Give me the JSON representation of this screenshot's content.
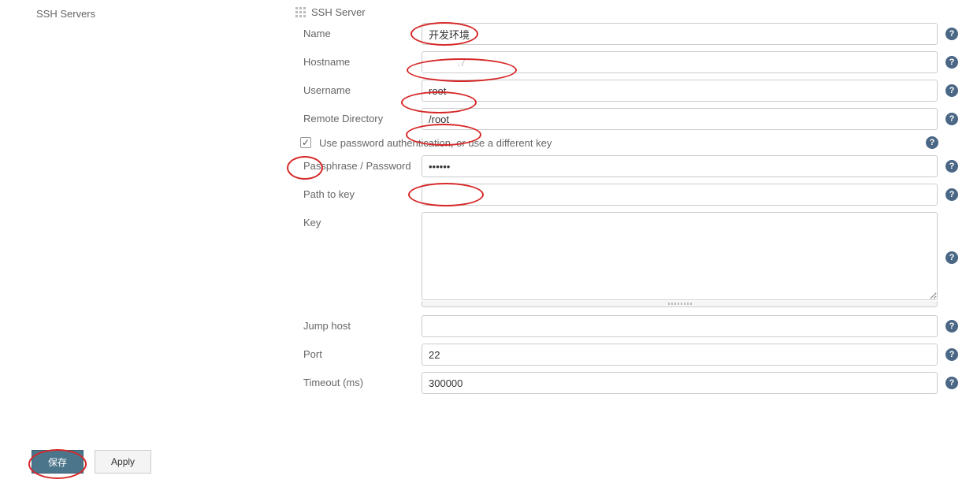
{
  "sidebar": {
    "label": "SSH Servers"
  },
  "section": {
    "title": "SSH Server"
  },
  "fields": {
    "name": {
      "label": "Name",
      "value": "开发环境"
    },
    "hostname": {
      "label": "Hostname",
      "value": "          .7"
    },
    "username": {
      "label": "Username",
      "value": "root"
    },
    "remote_dir": {
      "label": "Remote Directory",
      "value": "/root"
    },
    "use_pw": {
      "label": "Use password authentication, or use a different key",
      "checked": true
    },
    "passphrase": {
      "label": "Passphrase / Password",
      "value": "••••••"
    },
    "path_key": {
      "label": "Path to key",
      "value": ""
    },
    "key": {
      "label": "Key",
      "value": ""
    },
    "jump_host": {
      "label": "Jump host",
      "value": ""
    },
    "port": {
      "label": "Port",
      "value": "22"
    },
    "timeout": {
      "label": "Timeout (ms)",
      "value": "300000"
    }
  },
  "buttons": {
    "save": "保存",
    "apply": "Apply"
  },
  "help_glyph": "?"
}
